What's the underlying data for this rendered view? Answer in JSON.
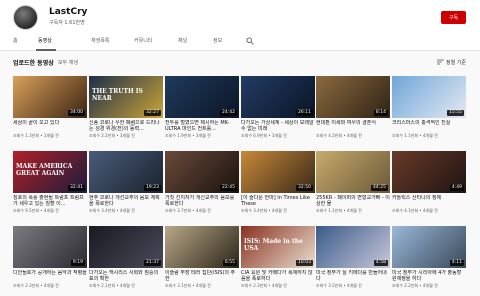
{
  "channel": {
    "name": "LastCry",
    "subscribers": "구독자 1.61만명",
    "subscribe_label": "구독"
  },
  "tabs": [
    {
      "label": "홈"
    },
    {
      "label": "동영상"
    },
    {
      "label": "재생목록"
    },
    {
      "label": "커뮤니티"
    },
    {
      "label": "채널"
    },
    {
      "label": "정보"
    }
  ],
  "icons": {
    "search": "search-icon",
    "sort": "sort-icon"
  },
  "section": {
    "title": "업로드한 동영상",
    "play_all": "모두 재생",
    "sort_label": "정렬 기준"
  },
  "videos": [
    {
      "title": "세상이 끝이 오고 있다",
      "meta": "조회수 1.3만회 • 1개월 전",
      "duration": "34:00",
      "colors": [
        "#d9a05a",
        "#3b2412"
      ]
    },
    {
      "title": "신종 코로나 우한 폐렴으로 드러나는 성경 위경(전)의 동력...",
      "meta": "조회수 2.2만회 • 3개월 전",
      "duration": "32:27",
      "colors": [
        "#1e2e4a",
        "#caa436"
      ],
      "overlay": "THE TRUTH IS NEAR"
    },
    {
      "title": "전투를 벌였으면 제시하는 MK-ULTRA 마인드 컨트롤...",
      "meta": "조회수 1.9만회 • 3개월 전",
      "duration": "24:42",
      "colors": [
        "#203a5c",
        "#0b1626"
      ]
    },
    {
      "title": "다가오는 가상세계 - 세상이 모래알 수 없는 미래",
      "meta": "조회수 6.9만회 • 3개월 전",
      "duration": "26:11",
      "colors": [
        "#233c66",
        "#0a1424"
      ]
    },
    {
      "title": "현대판 이세와 여우의 결혼식",
      "meta": "조회수 4.2만회 • 4개월 전",
      "duration": "8:14",
      "colors": [
        "#8c6a40",
        "#2e2214"
      ]
    },
    {
      "title": "크리스마스의 충격적인 진실",
      "meta": "조회수 1.1만회 • 4개월 전",
      "duration": "15:55",
      "colors": [
        "#6fa6d8",
        "#e4e9f2"
      ]
    },
    {
      "title": "칭호의 폭풍 출현될 트럼프 트럼프가 세우고 있는 칭할 이...",
      "meta": "조회수 9.5만회 • 4개월 전",
      "duration": "32:41",
      "colors": [
        "#b02028",
        "#1c1c3c"
      ],
      "overlay": "MAKE AMERICA GREAT AGAIN"
    },
    {
      "title": "현주 코로나 개선교주의 음모 계획을 폭로한다",
      "meta": "조회수 3.4만회 • 4개월 전",
      "duration": "19:23",
      "colors": [
        "#4a5c7a",
        "#1a222e"
      ]
    },
    {
      "title": "거짓 선지자가 개신교주의 음모를 폭로한다",
      "meta": "조회수 3.7만회 • 4개월 전",
      "duration": "22:45",
      "colors": [
        "#6a4a3a",
        "#1a120e"
      ]
    },
    {
      "title": "[이 즐다운 한마] In Times Like These",
      "meta": "조회수 3.4만회 • 4개월 전",
      "duration": "32:50",
      "colors": [
        "#c8883a",
        "#3a2a18"
      ]
    },
    {
      "title": "255KR - 페이퍼의 변형교가빠 - 이상한 물",
      "meta": "조회수 1.1만회 • 4개월 전",
      "duration": "44:25",
      "colors": [
        "#c8aa6a",
        "#6a5a3a"
      ]
    },
    {
      "title": "카톨릭스 산타나의 정체",
      "meta": "조회수 4.1만회 • 4개월 전",
      "duration": "4:49",
      "colors": [
        "#6a3a2a",
        "#1e1412"
      ]
    },
    {
      "title": "디안될로가 공개하는 음악과 적령을",
      "meta": "조회수 2.3만회 • 4개월 전",
      "duration": "9:19",
      "colors": [
        "#7a7a80",
        "#2a2a30"
      ]
    },
    {
      "title": "다가오는 캐시리스 사회와 짐승의 표의 확한",
      "meta": "조회수 2.1만회 • 4개월 전",
      "duration": "21:37",
      "colors": [
        "#1a1a22",
        "#4a4a5a"
      ]
    },
    {
      "title": "이슬람 무장 테러 집단(ISIS)의 주한",
      "meta": "조회수 3.1만회 • 4개월 전",
      "duration": "6:55",
      "colors": [
        "#b8a888",
        "#2a2418"
      ]
    },
    {
      "title": "CIA 요원 및 카메다가 폭재하지 않음을 폭로하다",
      "meta": "조회수 2.3만회 • 4개월 전",
      "duration": "10:03",
      "colors": [
        "#8a3020",
        "#e8e0d0"
      ],
      "overlay": "ISIS: Made in the USA"
    },
    {
      "title": "미국 정부가 실 키에다를 만들어내다",
      "meta": "조회수 3.5만회 • 4개월 전",
      "duration": "4:58",
      "colors": [
        "#3a5a8a",
        "#c8c8d8"
      ]
    },
    {
      "title": "미국 정부가 시리아에 4가 출동할 원재정을 하다",
      "meta": "조회수 2.2만회 • 4개월 전",
      "duration": "4:11",
      "colors": [
        "#9ab8d8",
        "#3a4a5a"
      ]
    }
  ]
}
